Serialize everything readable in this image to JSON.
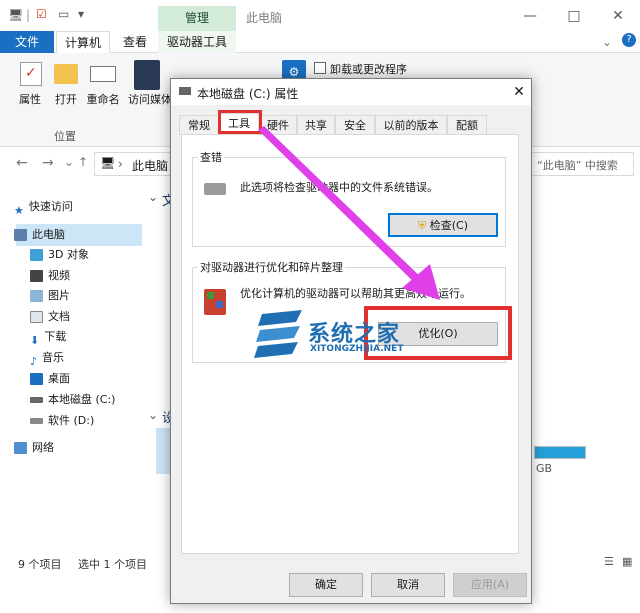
{
  "window": {
    "title": "此电脑",
    "context_group": "管理",
    "min_glyph": "—",
    "max_glyph": "□",
    "close_glyph": "✕"
  },
  "ribbon": {
    "tabs": [
      "文件",
      "计算机",
      "查看",
      "驱动器工具"
    ],
    "buttons": [
      "属性",
      "打开",
      "重命名",
      "访问媒体"
    ],
    "group_location": "位置",
    "uninstall_label": "卸载或更改程序"
  },
  "address": {
    "path_label": "此电脑",
    "search_placeholder": "“此电脑” 中搜索"
  },
  "nav": {
    "items": [
      "快速访问",
      "此电脑",
      "3D 对象",
      "视频",
      "图片",
      "文档",
      "下载",
      "音乐",
      "桌面",
      "本地磁盘 (C:)",
      "软件 (D:)",
      "网络"
    ]
  },
  "main": {
    "section1": "文",
    "section2": "设",
    "size_unit": "GB"
  },
  "status": {
    "count": "9 个项目",
    "selected": "选中 1 个项目"
  },
  "dialog": {
    "title": "本地磁盘 (C:) 属性",
    "tabs": [
      "常规",
      "工具",
      "硬件",
      "共享",
      "安全",
      "以前的版本",
      "配额"
    ],
    "check_group": "查错",
    "check_text": "此选项将检查驱动器中的文件系统错误。",
    "check_button": "检查(C)",
    "optimize_group": "对驱动器进行优化和碎片整理",
    "optimize_text": "优化计算机的驱动器可以帮助其更高效地运行。",
    "optimize_button": "优化(O)",
    "ok_button": "确定",
    "cancel_button": "取消",
    "apply_button": "应用(A)"
  },
  "watermark": {
    "title": "系统之家",
    "url": "XITONGZHIJIA.NET"
  },
  "colors": {
    "accent": "#1a6fc2",
    "highlight": "#e03030",
    "arrow": "#e040e8"
  }
}
